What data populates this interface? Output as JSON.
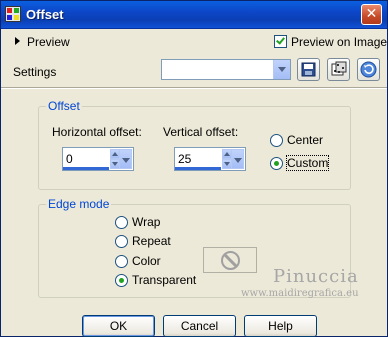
{
  "window": {
    "title": "Offset"
  },
  "preview": {
    "label": "Preview",
    "preview_on_image_label": "Preview on Image",
    "preview_on_image_checked": true
  },
  "settings": {
    "label": "Settings",
    "preset_value": ""
  },
  "offset": {
    "group_title": "Offset",
    "horizontal_label": "Horizontal offset:",
    "horizontal_value": "0",
    "vertical_label": "Vertical offset:",
    "vertical_value": "25",
    "center_label": "Center",
    "custom_label": "Custom",
    "selected": "Custom"
  },
  "edge_mode": {
    "group_title": "Edge mode",
    "options": [
      "Wrap",
      "Repeat",
      "Color",
      "Transparent"
    ],
    "selected": "Transparent"
  },
  "watermark": {
    "name": "Pinuccia",
    "url": "www.maidiregrafica.eu"
  },
  "buttons": {
    "ok": "OK",
    "cancel": "Cancel",
    "help": "Help"
  },
  "colors": {
    "title_bar": "#0a47c8",
    "group_title": "#0046d5",
    "radio_dot": "#21a121",
    "dialog_bg": "#ece9d8"
  },
  "icons": {
    "save": "save-icon",
    "randomize": "dice-icon",
    "reset": "reset-icon",
    "color": "no-color-icon"
  }
}
